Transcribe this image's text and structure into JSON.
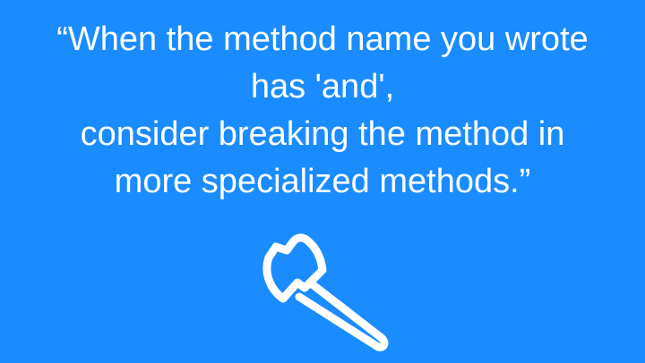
{
  "quote": {
    "line1": "“When the method name you wrote",
    "line2": "has 'and',",
    "line3": "consider breaking  the method in",
    "line4": "more specialized methods.”"
  },
  "icon": {
    "name": "axe-icon",
    "color": "#ffffff"
  },
  "colors": {
    "background": "#1a8cff",
    "text": "#ffffff"
  }
}
